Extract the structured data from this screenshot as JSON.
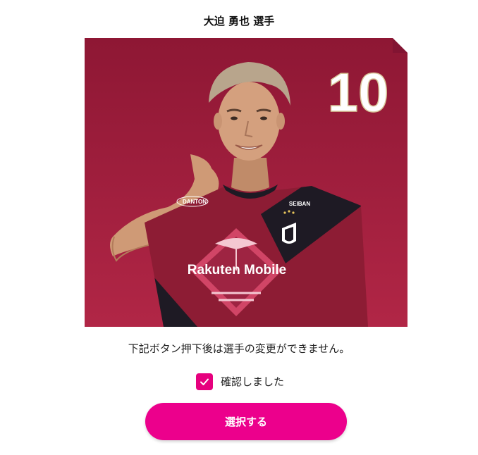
{
  "player": {
    "title": "大迫 勇也 選手",
    "jersey_number": "10",
    "shirt_sponsor": "Rakuten Mobile",
    "sleeve_sponsor": "SEIBAN",
    "kit_brand": "DANTON"
  },
  "notice": {
    "text": "下記ボタン押下後は選手の変更ができません。"
  },
  "confirm": {
    "checked": true,
    "label": "確認しました"
  },
  "action": {
    "select_label": "選択する"
  },
  "colors": {
    "accent": "#e6007e",
    "button": "#ec008c",
    "photo_background": "#a01f3f",
    "jersey_crimson": "#8d1c34",
    "jersey_dark": "#1e1a24"
  },
  "icons": {
    "checkbox": "check-icon"
  }
}
